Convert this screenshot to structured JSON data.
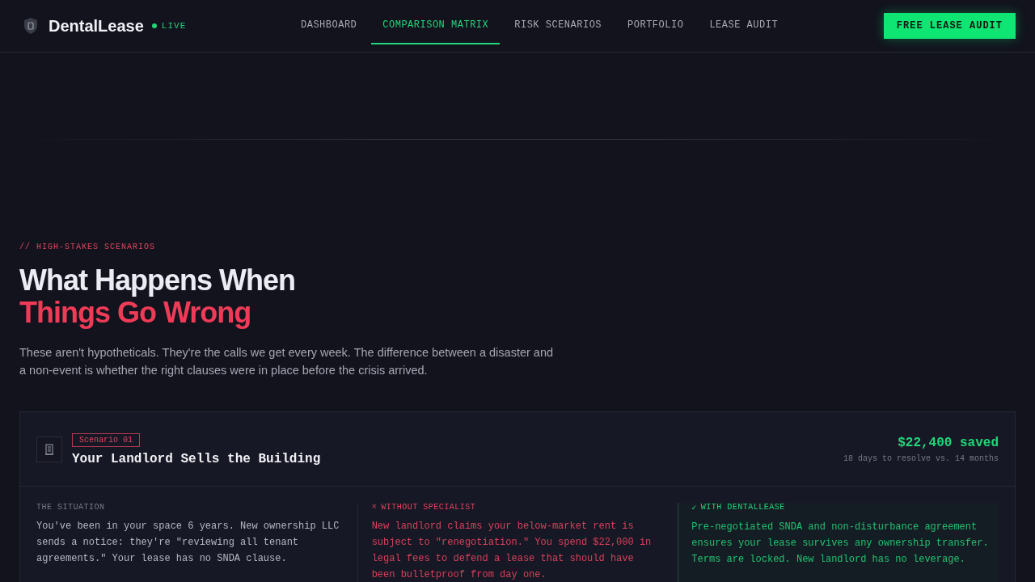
{
  "brand": {
    "name": "DentalLease",
    "status": "LIVE"
  },
  "nav": [
    {
      "label": "DASHBOARD",
      "selected": false
    },
    {
      "label": "COMPARISON MATRIX",
      "selected": true
    },
    {
      "label": "RISK SCENARIOS",
      "selected": false
    },
    {
      "label": "PORTFOLIO",
      "selected": false
    },
    {
      "label": "LEASE AUDIT",
      "selected": false
    }
  ],
  "cta": "FREE LEASE AUDIT",
  "section": {
    "eyebrow": "// HIGH-STAKES SCENARIOS",
    "title_line_1": "What Happens When",
    "title_line_2": "Things Go Wrong",
    "intro": "These aren't hypotheticals. They're the calls we get every week. The difference between a disaster and a non-event is whether the right clauses were in place before the crisis arrived."
  },
  "scenario": {
    "tag": "Scenario 01",
    "title": "Your Landlord Sells the Building",
    "savings": "$22,400 saved",
    "resolution": "18 days to resolve vs. 14 months",
    "columns": [
      {
        "kind": "situation",
        "heading": "THE SITUATION",
        "text": "You've been in your space 6 years. New ownership LLC sends a notice: they're \"reviewing all tenant agreements.\" Your lease has no SNDA clause."
      },
      {
        "kind": "without",
        "icon": "×",
        "heading": "WITHOUT SPECIALIST",
        "text": "New landlord claims your below-market rent is subject to \"renegotiation.\" You spend $22,000 in legal fees to defend a lease that should have been bulletproof from day one."
      },
      {
        "kind": "with",
        "icon": "✓",
        "heading": "WITH DENTALLEASE",
        "text": "Pre-negotiated SNDA and non-disturbance agreement ensures your lease survives any ownership transfer. Terms are locked. New landlord has no leverage."
      }
    ]
  }
}
